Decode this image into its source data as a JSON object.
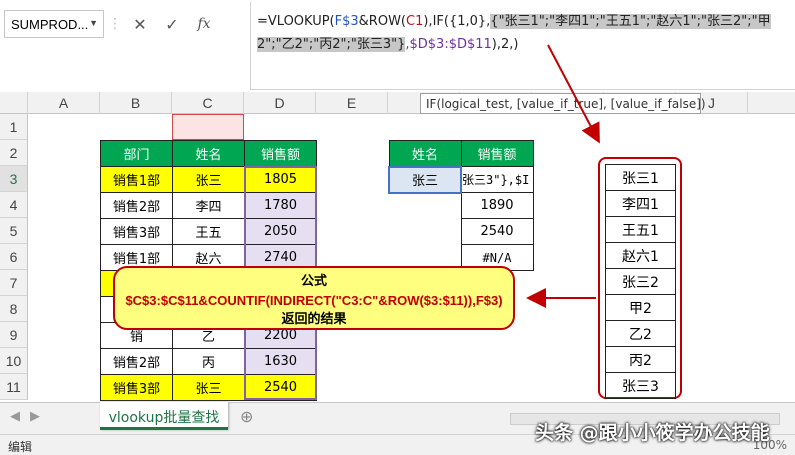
{
  "namebox": {
    "value": "SUMPROD..."
  },
  "fx_buttons": {
    "cancel": "✕",
    "confirm": "✓",
    "fx": "fx"
  },
  "formula": {
    "p1": "=VLOOKUP(",
    "p2": "F$3",
    "p3": "&ROW(",
    "p4": "C1",
    "p5": "),IF({1,0},",
    "p6": "{\"张三1\";\"李四1\";\"王五1\";\"赵六1\";\"张三2\";\"甲2\";\"乙2\";\"丙2\";\"张三3\"}",
    "p7": ",$D$3:$D$11",
    "p8": "),2,)"
  },
  "tooltip": {
    "text": "IF(logical_test, [value_if_true], [value_if_false])"
  },
  "columns": [
    "A",
    "B",
    "C",
    "D",
    "E",
    "F",
    "G",
    "H",
    "I",
    "J"
  ],
  "rows": [
    "1",
    "2",
    "3",
    "4",
    "5",
    "6",
    "7",
    "8",
    "9",
    "10",
    "11"
  ],
  "left_table": {
    "headers": [
      "部门",
      "姓名",
      "销售额"
    ],
    "rows": [
      [
        "销售1部",
        "张三",
        "1805"
      ],
      [
        "销售2部",
        "李四",
        "1780"
      ],
      [
        "销售3部",
        "王五",
        "2050"
      ],
      [
        "销售1部",
        "赵六",
        "2740"
      ],
      [
        "销",
        "",
        ""
      ],
      [
        "销",
        "",
        ""
      ],
      [
        "销",
        "乙",
        "2200"
      ],
      [
        "销售2部",
        "丙",
        "1630"
      ],
      [
        "销售3部",
        "张三",
        "2540"
      ]
    ]
  },
  "right_table": {
    "headers": [
      "姓名",
      "销售额"
    ],
    "lookup_name": "张三",
    "edit_cell": "张三3\"},$I",
    "values": [
      "1890",
      "2540",
      "#N/A"
    ]
  },
  "callout": {
    "line1": "公式",
    "line2": "$C$3:$C$11&COUNTIF(INDIRECT(\"C3:C\"&ROW($3:$11)),F$3)",
    "line3": "返回的结果"
  },
  "result_list": [
    "张三1",
    "李四1",
    "王五1",
    "赵六1",
    "张三2",
    "甲2",
    "乙2",
    "丙2",
    "张三3"
  ],
  "sheet_tab": {
    "label": "vlookup批量查找"
  },
  "status": {
    "mode": "编辑",
    "zoom": "100%"
  },
  "watermark": {
    "text": "头条 @跟小小筱学办公技能"
  }
}
